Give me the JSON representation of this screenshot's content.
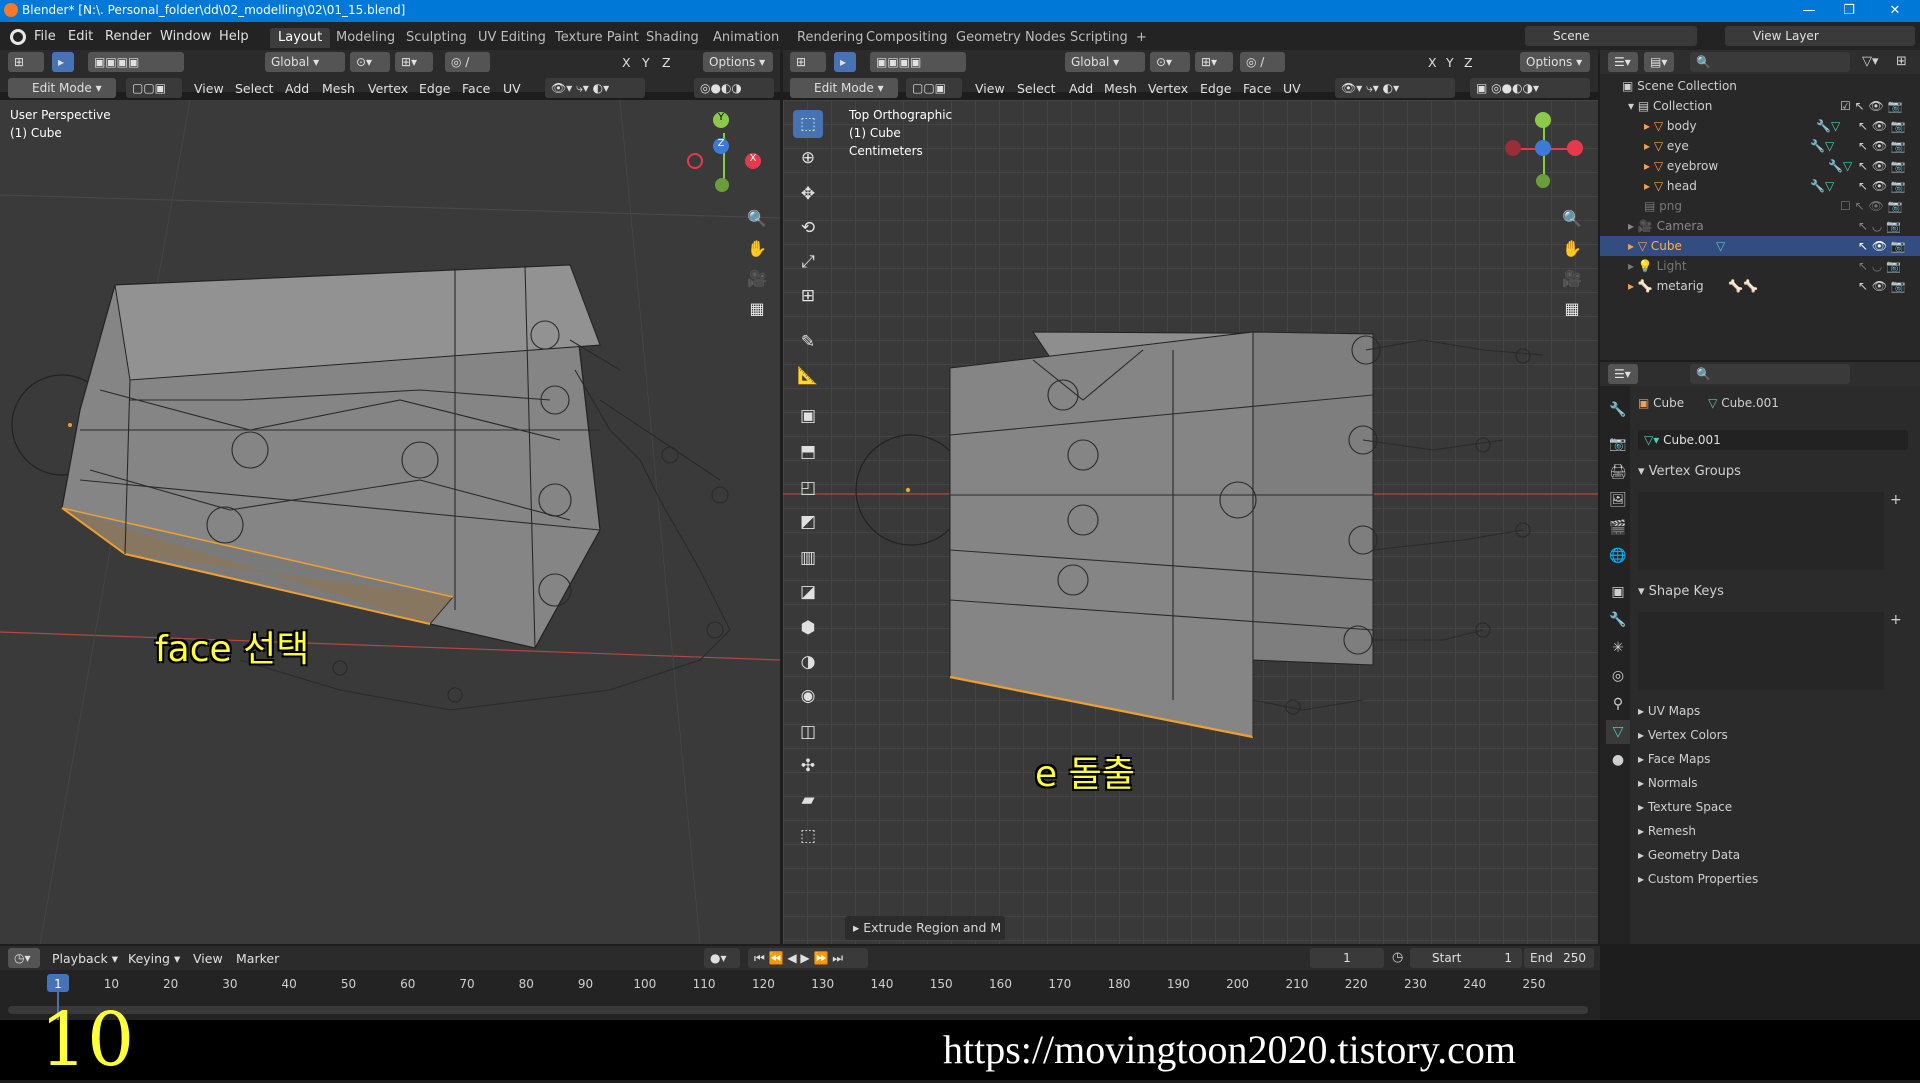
{
  "window": {
    "title": "Blender* [N:\\. Personal_folder\\dd\\02_modelling\\02\\01_15.blend]",
    "min": "—",
    "max": "❐",
    "close": "✕"
  },
  "menu": [
    "File",
    "Edit",
    "Render",
    "Window",
    "Help"
  ],
  "workspaces": [
    "Layout",
    "Modeling",
    "Sculpting",
    "UV Editing",
    "Texture Paint",
    "Shading",
    "Animation",
    "Rendering",
    "Compositing",
    "Geometry Nodes",
    "Scripting",
    "+"
  ],
  "scene": {
    "label": "Scene",
    "view_layer": "View Layer"
  },
  "left_view": {
    "orientation": "Global",
    "options": "Options",
    "mode": "Edit Mode",
    "menus": [
      "View",
      "Select",
      "Add",
      "Mesh",
      "Vertex",
      "Edge",
      "Face",
      "UV"
    ],
    "overlay_title": "User Perspective",
    "overlay_sub": "(1) Cube",
    "axis_x": "X",
    "axis_y": "Y",
    "axis_z": "Z"
  },
  "right_view": {
    "orientation": "Global",
    "options": "Options",
    "mode": "Edit Mode",
    "menus": [
      "View",
      "Select",
      "Add",
      "Mesh",
      "Vertex",
      "Edge",
      "Face",
      "UV"
    ],
    "overlay_title": "Top Orthographic",
    "overlay_sub": "(1) Cube",
    "overlay_units": "Centimeters",
    "operator_panel": "Extrude Region and M"
  },
  "xyz": [
    "X",
    "Y",
    "Z"
  ],
  "outliner": {
    "root": "Scene Collection",
    "collection": "Collection",
    "items": [
      {
        "name": "body"
      },
      {
        "name": "eye"
      },
      {
        "name": "eyebrow"
      },
      {
        "name": "head"
      },
      {
        "name": "png"
      },
      {
        "name": "Camera"
      },
      {
        "name": "Cube",
        "selected": true
      },
      {
        "name": "Light"
      },
      {
        "name": "metarig"
      }
    ]
  },
  "properties": {
    "object": "Cube",
    "mesh": "Cube.001",
    "mesh_field": "Cube.001",
    "sections": [
      "Vertex Groups",
      "Shape Keys",
      "UV Maps",
      "Vertex Colors",
      "Face Maps",
      "Normals",
      "Texture Space",
      "Remesh",
      "Geometry Data",
      "Custom Properties"
    ]
  },
  "timeline": {
    "menus": [
      "Playback",
      "Keying",
      "View",
      "Marker"
    ],
    "current_frame": "1",
    "start_label": "Start",
    "start": "1",
    "end_label": "End",
    "end": "250",
    "ticks": [
      "1",
      "10",
      "20",
      "30",
      "40",
      "50",
      "60",
      "70",
      "80",
      "90",
      "100",
      "110",
      "120",
      "130",
      "140",
      "150",
      "160",
      "170",
      "180",
      "190",
      "200",
      "210",
      "220",
      "230",
      "240",
      "250"
    ]
  },
  "overlays": {
    "left_caption": "face 선택",
    "right_caption": "e 돌출",
    "step": "10",
    "url": "https://movingtoon2020.tistory.com"
  },
  "colors": {
    "accent": "#4772b3",
    "selection": "#f0a030",
    "caption": "#ffff3a"
  }
}
